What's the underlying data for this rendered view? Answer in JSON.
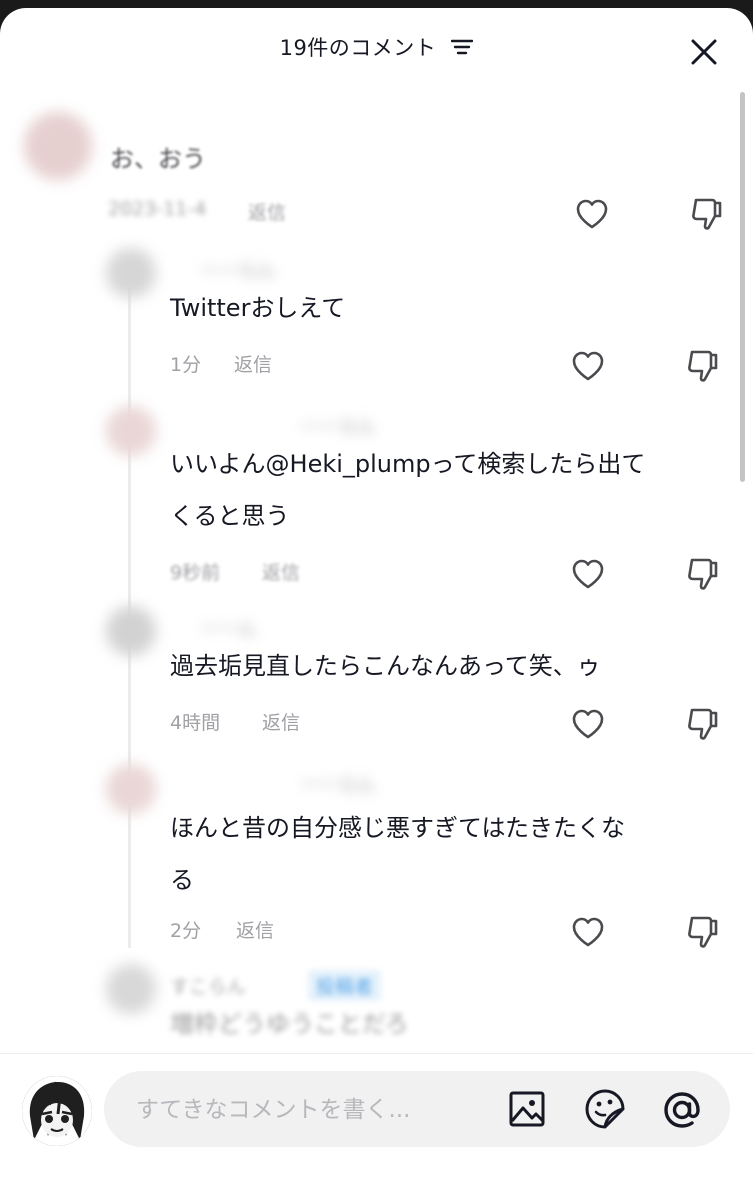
{
  "header": {
    "title": "19件のコメント"
  },
  "comments": [
    {
      "text": "お、おう",
      "date": "2023-11-4",
      "reply": "返信"
    },
    {
      "author": "ーーらん",
      "text": "Twitterおしえて",
      "time": "1分",
      "reply": "返信"
    },
    {
      "author": "ーーらん",
      "text_line1": "いいよん@Heki_plumpって検索したら出て",
      "text_line2": "くると思う",
      "time": "9秒前",
      "reply": "返信"
    },
    {
      "author": "ーーん",
      "text": "過去垢見直したらこんなんあって笑、ゥ",
      "time": "4時間",
      "reply": "返信"
    },
    {
      "author": "ーーらん",
      "text_line1": "ほんと昔の自分感じ悪すぎてはたきたくな",
      "text_line2": "る",
      "time": "2分",
      "reply": "返信"
    },
    {
      "author": "すこらん",
      "badge": "投稿者",
      "text": "増枠どうゆうことだろ"
    }
  ],
  "composer": {
    "placeholder": "すてきなコメントを書く..."
  },
  "icons": {
    "filter": "filter-lines-icon",
    "close": "close-icon",
    "like": "heart-outline-icon",
    "dislike": "thumbs-down-outline-icon",
    "image": "image-icon",
    "emoji": "emoji-sticker-icon",
    "mention": "at-mention-icon"
  }
}
